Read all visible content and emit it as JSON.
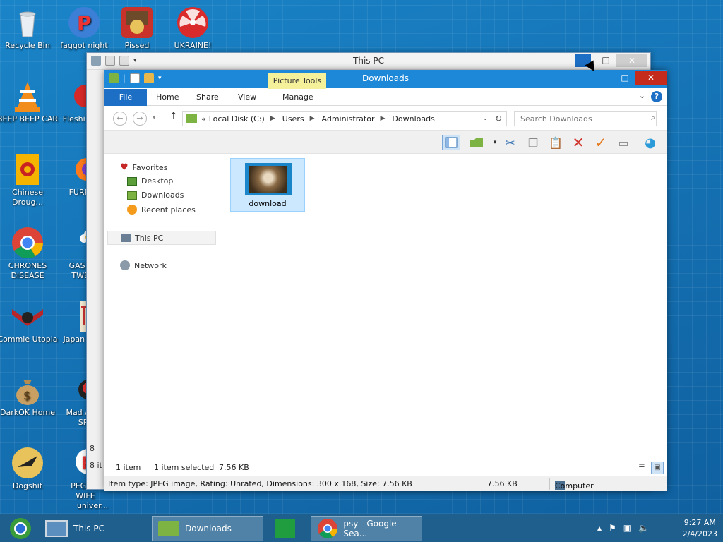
{
  "desktop": {
    "icons": [
      {
        "label": "Recycle Bin"
      },
      {
        "label": "faggot night"
      },
      {
        "label": "Pissed"
      },
      {
        "label": "UKRAINE!"
      },
      {
        "label": "BEEP BEEP CAR"
      },
      {
        "label": "Fleshi DELU"
      },
      {
        "label": "Chinese Droug..."
      },
      {
        "label": "FURRY C"
      },
      {
        "label": "CHRONES DISEASE"
      },
      {
        "label": "GAS STA TWEAK"
      },
      {
        "label": "Commie Utopia"
      },
      {
        "label": "Japan Loli P"
      },
      {
        "label": "DarkOK Home"
      },
      {
        "label": "Mad Av IN SPA"
      },
      {
        "label": "Dogshit"
      },
      {
        "label": "PEG MY WIFE"
      },
      {
        "label": "univer..."
      }
    ]
  },
  "back_window": {
    "title": "This PC",
    "status_items": "8 it",
    "side_number": "8"
  },
  "window": {
    "title": "Downloads",
    "contextual_tab": "Picture Tools",
    "tabs": [
      "File",
      "Home",
      "Share",
      "View",
      "Manage"
    ],
    "help": "?",
    "address": {
      "prefix": "«",
      "crumbs": [
        "Local Disk (C:)",
        "Users",
        "Administrator",
        "Downloads"
      ]
    },
    "search_placeholder": "Search Downloads",
    "nav": {
      "favorites": "Favorites",
      "desktop": "Desktop",
      "downloads": "Downloads",
      "recent": "Recent places",
      "this_pc": "This PC",
      "network": "Network"
    },
    "file": {
      "name": "download"
    },
    "status": {
      "count": "1 item",
      "selected": "1 item selected",
      "size": "7.56 KB"
    },
    "details": {
      "info": "Item type: JPEG image, Rating: Unrated, Dimensions: 300 x 168, Size: 7.56 KB",
      "size": "7.56 KB",
      "location": "Computer"
    }
  },
  "taskbar": {
    "tasks": [
      "This PC",
      "Downloads",
      "psy - Google Sea..."
    ],
    "time": "9:27 AM",
    "date": "2/4/2023"
  },
  "colors": {
    "accent": "#1e88d8",
    "file_tab": "#1c6fc5",
    "close": "#c42b1c",
    "contextual": "#f5f09a",
    "selection": "#cce8ff"
  }
}
